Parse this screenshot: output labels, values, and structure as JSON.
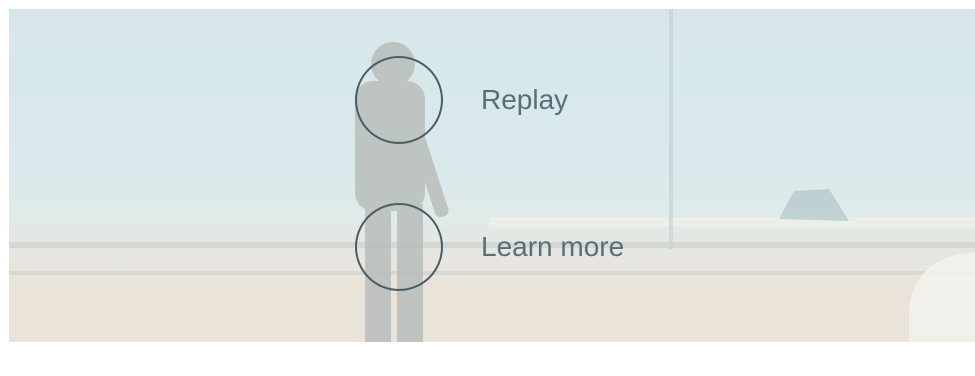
{
  "end_screen": {
    "replay_label": "Replay",
    "learn_more_label": "Learn more"
  },
  "colors": {
    "ring": "#4a5c66",
    "label": "#56707a",
    "sky": "#d3e6ea"
  }
}
